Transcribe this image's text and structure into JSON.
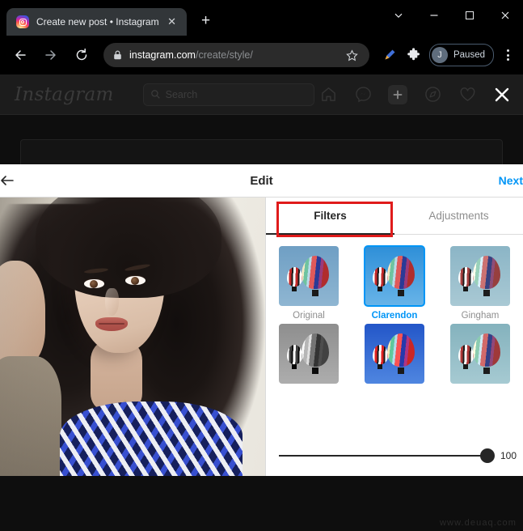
{
  "browser": {
    "tab": {
      "title": "Create new post • Instagram",
      "favicon": "instagram-favicon",
      "close_label": "✕"
    },
    "new_tab_label": "+",
    "window_controls": {
      "tab_search": "tab-search-chevron",
      "minimize": "—",
      "maximize": "maximize-square",
      "close": "✕"
    },
    "toolbar": {
      "back": "back-arrow",
      "forward": "forward-arrow",
      "reload": "reload-arrow",
      "lock": "lock-icon",
      "url_domain": "instagram.com",
      "url_path": "/create/style/",
      "bookmark": "☆",
      "highlighter_ext": "highlighter-icon",
      "extensions": "puzzle-piece-icon",
      "profile_initial": "J",
      "profile_status": "Paused",
      "menu": "three-dot-menu"
    }
  },
  "instagram": {
    "logo": "Instagram",
    "search_placeholder": "Search",
    "nav_icons": [
      {
        "name": "home-icon",
        "label": "Home"
      },
      {
        "name": "messenger-icon",
        "label": "Messages"
      },
      {
        "name": "new-post-icon",
        "label": "New post"
      },
      {
        "name": "explore-icon",
        "label": "Explore"
      },
      {
        "name": "heart-icon",
        "label": "Activity"
      },
      {
        "name": "close-icon",
        "label": "Close"
      }
    ],
    "watermark": "www.deuaq.com"
  },
  "edit_modal": {
    "back_label": "←",
    "title": "Edit",
    "next_label": "Next",
    "tabs": [
      {
        "label": "Filters",
        "active": true
      },
      {
        "label": "Adjustments",
        "active": false
      }
    ],
    "filters": [
      {
        "label": "Original",
        "selected": false,
        "style": "original"
      },
      {
        "label": "Clarendon",
        "selected": true,
        "style": "clarendon"
      },
      {
        "label": "Gingham",
        "selected": false,
        "style": "gingham"
      },
      {
        "label": "",
        "selected": false,
        "style": "moon"
      },
      {
        "label": "",
        "selected": false,
        "style": "lark"
      },
      {
        "label": "",
        "selected": false,
        "style": "reyes"
      }
    ],
    "slider": {
      "value": "100",
      "display_value": "100",
      "min": "0",
      "max": "100"
    }
  },
  "annotation": {
    "color": "#e01b1b",
    "target": "Filters"
  }
}
